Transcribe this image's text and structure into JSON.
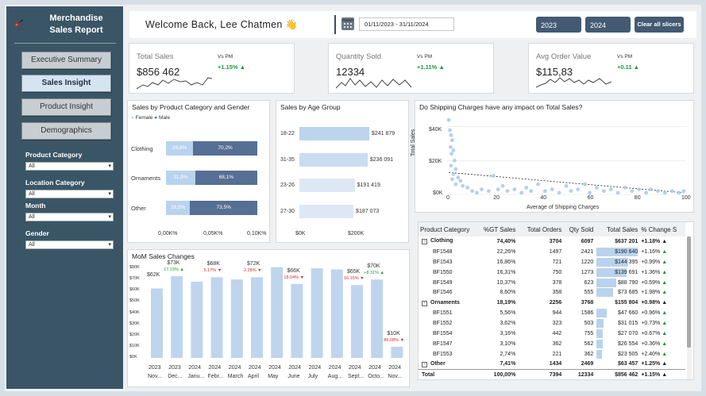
{
  "report": {
    "title_line1": "Merchandise",
    "title_line2": "Sales Report"
  },
  "nav": [
    {
      "label": "Executive Summary",
      "active": false
    },
    {
      "label": "Sales Insight",
      "active": true
    },
    {
      "label": "Product Insight",
      "active": false
    },
    {
      "label": "Demographics",
      "active": false
    }
  ],
  "filters": [
    {
      "label": "Product Category",
      "value": "All"
    },
    {
      "label": "Location Category",
      "value": "All"
    },
    {
      "label": "Month",
      "value": "All"
    },
    {
      "label": "Gender",
      "value": "All"
    }
  ],
  "header": {
    "welcome": "Welcome Back, Lee Chatmen",
    "wave_emoji": "👋",
    "date_range": "01/11/2023 - 31/11/2024",
    "year1": "2023",
    "year2": "2024",
    "clear": "Clear all slicers"
  },
  "kpis": [
    {
      "title": "Total Sales",
      "value": "$856 462",
      "vs": "Vs PM",
      "change": "+1.15% ▲"
    },
    {
      "title": "Quantity Sold",
      "value": "12334",
      "vs": "Vs PM",
      "change": "+1.11% ▲"
    },
    {
      "title": "Avg Order Value",
      "value": "$115,83",
      "vs": "Vs PM",
      "change": "+0.11 ▲"
    }
  ],
  "gender_chart": {
    "title": "Sales by Product Category and Gender",
    "legend": [
      "Female",
      "Male"
    ],
    "colors": {
      "female": "#b9d3ee",
      "male": "#566f94"
    },
    "categories": [
      "Clothing",
      "Ornaments",
      "Other"
    ],
    "female": [
      "29,8%",
      "31,9%",
      "26,5%"
    ],
    "male": [
      "70,2%",
      "68,1%",
      "73,5%"
    ],
    "ticks": [
      "0,00K%",
      "0,05K%",
      "0,10K%"
    ]
  },
  "age_chart": {
    "title": "Sales by Age Group",
    "labels": [
      "18-22",
      "31-35",
      "23-26",
      "27-30"
    ],
    "values": [
      "$241 879",
      "$236 091",
      "$191 419",
      "$187 073"
    ],
    "ticks": [
      "$0K",
      "$200K"
    ]
  },
  "scatter": {
    "title": "Do Shipping Charges have any impact on Total Sales?",
    "ylabel": "Total Sales",
    "xlabel": "Average of Shipping Charges",
    "yticks": [
      "$40K",
      "$20K",
      "$0K"
    ],
    "xticks": [
      "0",
      "20",
      "40",
      "60",
      "80",
      "100"
    ]
  },
  "mom": {
    "title": "MoM Sales Changes",
    "yticks": [
      "$80K",
      "$70K",
      "$60K",
      "$50K",
      "$40K",
      "$30K",
      "$20K",
      "$10K",
      "$0K"
    ],
    "labels": [
      {
        "value": "$62K",
        "pct": ""
      },
      {
        "value": "$73K",
        "pct": "17.19% ▲"
      },
      {
        "value": "$68K",
        "pct": "5.17% ▼"
      },
      {
        "value": "$72K",
        "pct": "2.28% ▼"
      },
      {
        "value": "$66K",
        "pct": "18.04% ▼"
      },
      {
        "value": "$65K",
        "pct": "16.15% ▼"
      },
      {
        "value": "$70K",
        "pct": "+8.31% ▲"
      },
      {
        "value": "$10K",
        "pct": "86.08% ▼"
      }
    ],
    "years": [
      "2023",
      "2023",
      "2024",
      "2024",
      "2024",
      "2024",
      "2024",
      "2024",
      "2024",
      "2024",
      "2024",
      "2024",
      "2024"
    ],
    "months": [
      "Nov...",
      "Dec...",
      "Janu...",
      "Febr...",
      "March",
      "April",
      "May",
      "June",
      "July",
      "Aug...",
      "Sept...",
      "Octo...",
      "Nov..."
    ]
  },
  "chart_data": [
    {
      "type": "bar",
      "title": "MoM Sales Changes",
      "categories": [
        "Nov 2023",
        "Dec 2023",
        "Jan 2024",
        "Feb 2024",
        "Mar 2024",
        "Apr 2024",
        "May 2024",
        "Jun 2024",
        "Jul 2024",
        "Aug 2024",
        "Sep 2024",
        "Oct 2024",
        "Nov 2024"
      ],
      "values": [
        62,
        73,
        68,
        72,
        70,
        72,
        81,
        66,
        80,
        79,
        65,
        70,
        10
      ],
      "ylim": [
        0,
        85
      ]
    },
    {
      "type": "scatter",
      "title": "Do Shipping Charges have any impact on Total Sales?",
      "xlabel": "Average of Shipping Charges",
      "ylabel": "Total Sales",
      "xlim": [
        0,
        100
      ],
      "ylim": [
        0,
        45
      ],
      "points": [
        [
          0,
          44
        ],
        [
          0.5,
          38
        ],
        [
          1,
          35
        ],
        [
          1.5,
          32
        ],
        [
          0.8,
          28
        ],
        [
          1.2,
          24
        ],
        [
          2,
          26
        ],
        [
          2.5,
          20
        ],
        [
          1,
          17
        ],
        [
          3,
          15
        ],
        [
          2,
          12
        ],
        [
          1.5,
          9
        ],
        [
          4,
          10
        ],
        [
          5,
          8
        ],
        [
          3,
          6
        ],
        [
          6,
          5
        ],
        [
          8,
          4
        ],
        [
          10,
          2
        ],
        [
          12,
          1
        ],
        [
          14,
          3
        ],
        [
          17,
          2
        ],
        [
          19,
          11
        ],
        [
          21,
          3
        ],
        [
          23,
          5
        ],
        [
          25,
          2
        ],
        [
          28,
          3
        ],
        [
          31,
          1
        ],
        [
          33,
          4
        ],
        [
          35,
          2
        ],
        [
          38,
          6
        ],
        [
          41,
          2
        ],
        [
          44,
          3
        ],
        [
          47,
          1
        ],
        [
          50,
          5
        ],
        [
          52,
          2
        ],
        [
          55,
          3
        ],
        [
          58,
          6
        ],
        [
          60,
          1
        ],
        [
          63,
          4
        ],
        [
          66,
          2
        ],
        [
          69,
          3
        ],
        [
          72,
          1
        ],
        [
          75,
          4
        ],
        [
          78,
          2
        ],
        [
          81,
          3
        ],
        [
          84,
          1
        ],
        [
          86,
          3
        ],
        [
          89,
          2
        ],
        [
          92,
          1
        ],
        [
          95,
          2
        ],
        [
          98,
          1
        ],
        [
          100,
          2
        ]
      ]
    }
  ],
  "matrix": {
    "headers": [
      "Product Category",
      "%GT Sales",
      "Total Orders",
      "Qty Sold",
      "Total Sales",
      "% Change S"
    ],
    "rows": [
      {
        "kind": "group",
        "name": "Clothing",
        "pct": "74,40%",
        "orders": "3704",
        "qty": "6097",
        "sales": "$637 201",
        "chg": "+1.18%",
        "dir": "▲",
        "bar": 0
      },
      {
        "kind": "item",
        "name": "BF1548",
        "pct": "22,26%",
        "orders": "1497",
        "qty": "2421",
        "sales": "$190 640",
        "chg": "+1.16%",
        "dir": "▲",
        "bar": 1.0
      },
      {
        "kind": "item",
        "name": "BF1543",
        "pct": "16,86%",
        "orders": "721",
        "qty": "1220",
        "sales": "$144 395",
        "chg": "+0.99%",
        "dir": "▲",
        "bar": 0.76
      },
      {
        "kind": "item",
        "name": "BF1550",
        "pct": "16,31%",
        "orders": "750",
        "qty": "1273",
        "sales": "$139 691",
        "chg": "+1.36%",
        "dir": "▲",
        "bar": 0.73
      },
      {
        "kind": "item",
        "name": "BF1549",
        "pct": "10,37%",
        "orders": "378",
        "qty": "623",
        "sales": "$88 790",
        "chg": "+0.59%",
        "dir": "▲",
        "bar": 0.47
      },
      {
        "kind": "item",
        "name": "BF1546",
        "pct": "8,60%",
        "orders": "358",
        "qty": "555",
        "sales": "$73 685",
        "chg": "+1.98%",
        "dir": "▲",
        "bar": 0.39
      },
      {
        "kind": "group",
        "name": "Ornaments",
        "pct": "18,19%",
        "orders": "2256",
        "qty": "3768",
        "sales": "$155 804",
        "chg": "+0.98%",
        "dir": "▲",
        "bar": 0
      },
      {
        "kind": "item",
        "name": "BF1551",
        "pct": "5,56%",
        "orders": "944",
        "qty": "1586",
        "sales": "$47 660",
        "chg": "+0.96%",
        "dir": "▲",
        "bar": 0.25
      },
      {
        "kind": "item",
        "name": "BF1552",
        "pct": "3,62%",
        "orders": "323",
        "qty": "503",
        "sales": "$31 015",
        "chg": "+0.73%",
        "dir": "▲",
        "bar": 0.16
      },
      {
        "kind": "item",
        "name": "BF1554",
        "pct": "3,16%",
        "orders": "442",
        "qty": "755",
        "sales": "$27 070",
        "chg": "+0.67%",
        "dir": "▲",
        "bar": 0.14
      },
      {
        "kind": "item",
        "name": "BF1547",
        "pct": "3,10%",
        "orders": "362",
        "qty": "562",
        "sales": "$26 554",
        "chg": "+0.36%",
        "dir": "▲",
        "bar": 0.14
      },
      {
        "kind": "item",
        "name": "BF1553",
        "pct": "2,74%",
        "orders": "221",
        "qty": "362",
        "sales": "$23 505",
        "chg": "+2.40%",
        "dir": "▲",
        "bar": 0.12
      },
      {
        "kind": "group",
        "name": "Other",
        "pct": "7,41%",
        "orders": "1434",
        "qty": "2469",
        "sales": "$63 457",
        "chg": "+1.25%",
        "dir": "▲",
        "bar": 0
      },
      {
        "kind": "total",
        "name": "Total",
        "pct": "100,00%",
        "orders": "7394",
        "qty": "12334",
        "sales": "$856 462",
        "chg": "+1.15%",
        "dir": "▲",
        "bar": 0
      }
    ]
  }
}
